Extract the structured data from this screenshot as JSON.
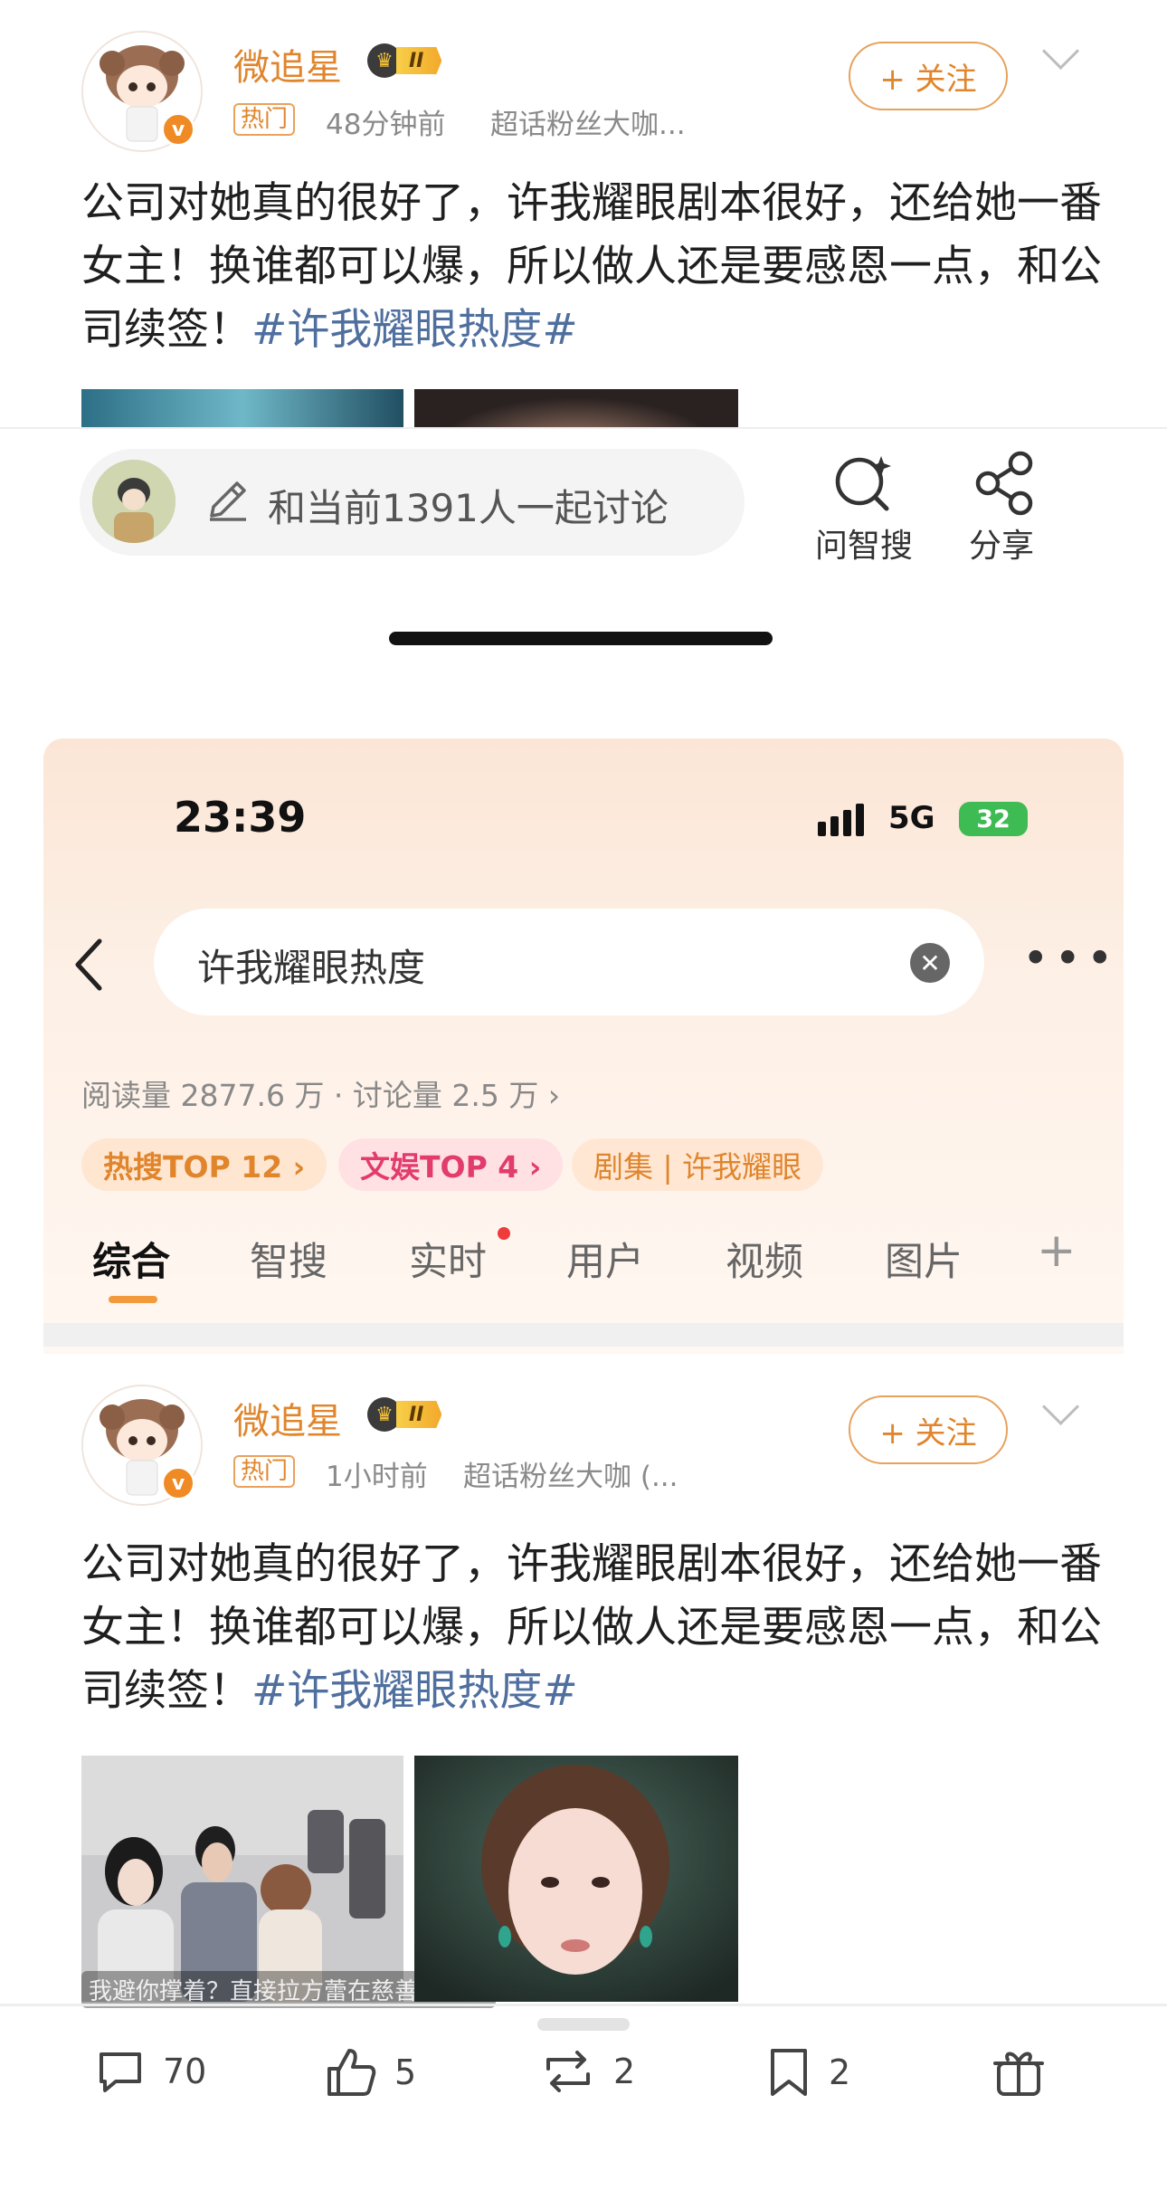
{
  "top_post": {
    "username": "微追星",
    "level_badge": "II",
    "tag": "热门",
    "time": "48分钟前",
    "source": "超话粉丝大咖...",
    "follow_label": "+ 关注",
    "text": "公司对她真的很好了，许我耀眼剧本很好，还给她一番女主！换谁都可以爆，所以做人还是要感恩一点，和公司续签！",
    "hashtag": "#许我耀眼热度#"
  },
  "discuss_bar": {
    "placeholder": "和当前1391人一起讨论",
    "ask_label": "问智搜",
    "share_label": "分享"
  },
  "status_bar": {
    "time": "23:39",
    "network": "5G",
    "battery": "32"
  },
  "search": {
    "query": "许我耀眼热度"
  },
  "topic_stats": "阅读量 2877.6 万 · 讨论量 2.5 万 ›",
  "pills": [
    {
      "label": "热搜TOP 12 ›",
      "color": "#e0852c"
    },
    {
      "label": "文娱TOP 4 ›",
      "color": "#e23b6e"
    },
    {
      "label": "剧集 | 许我耀眼",
      "color": "#e0852c"
    }
  ],
  "tabs": [
    "综合",
    "智搜",
    "实时",
    "用户",
    "视频",
    "图片",
    "+"
  ],
  "second_post": {
    "username": "微追星",
    "level_badge": "II",
    "tag": "热门",
    "time": "1小时前",
    "source": "超话粉丝大咖 (...",
    "follow_label": "+ 关注",
    "text": "公司对她真的很好了，许我耀眼剧本很好，还给她一番女主！换谁都可以爆，所以做人还是要感恩一点，和公司续签！",
    "hashtag": "#许我耀眼热度#",
    "image_caption": "我避你撑着？直接拉方蕾在慈善会同桌"
  },
  "toolbar": {
    "comments": "70",
    "likes": "5",
    "reposts": "2",
    "favorites": "2"
  }
}
